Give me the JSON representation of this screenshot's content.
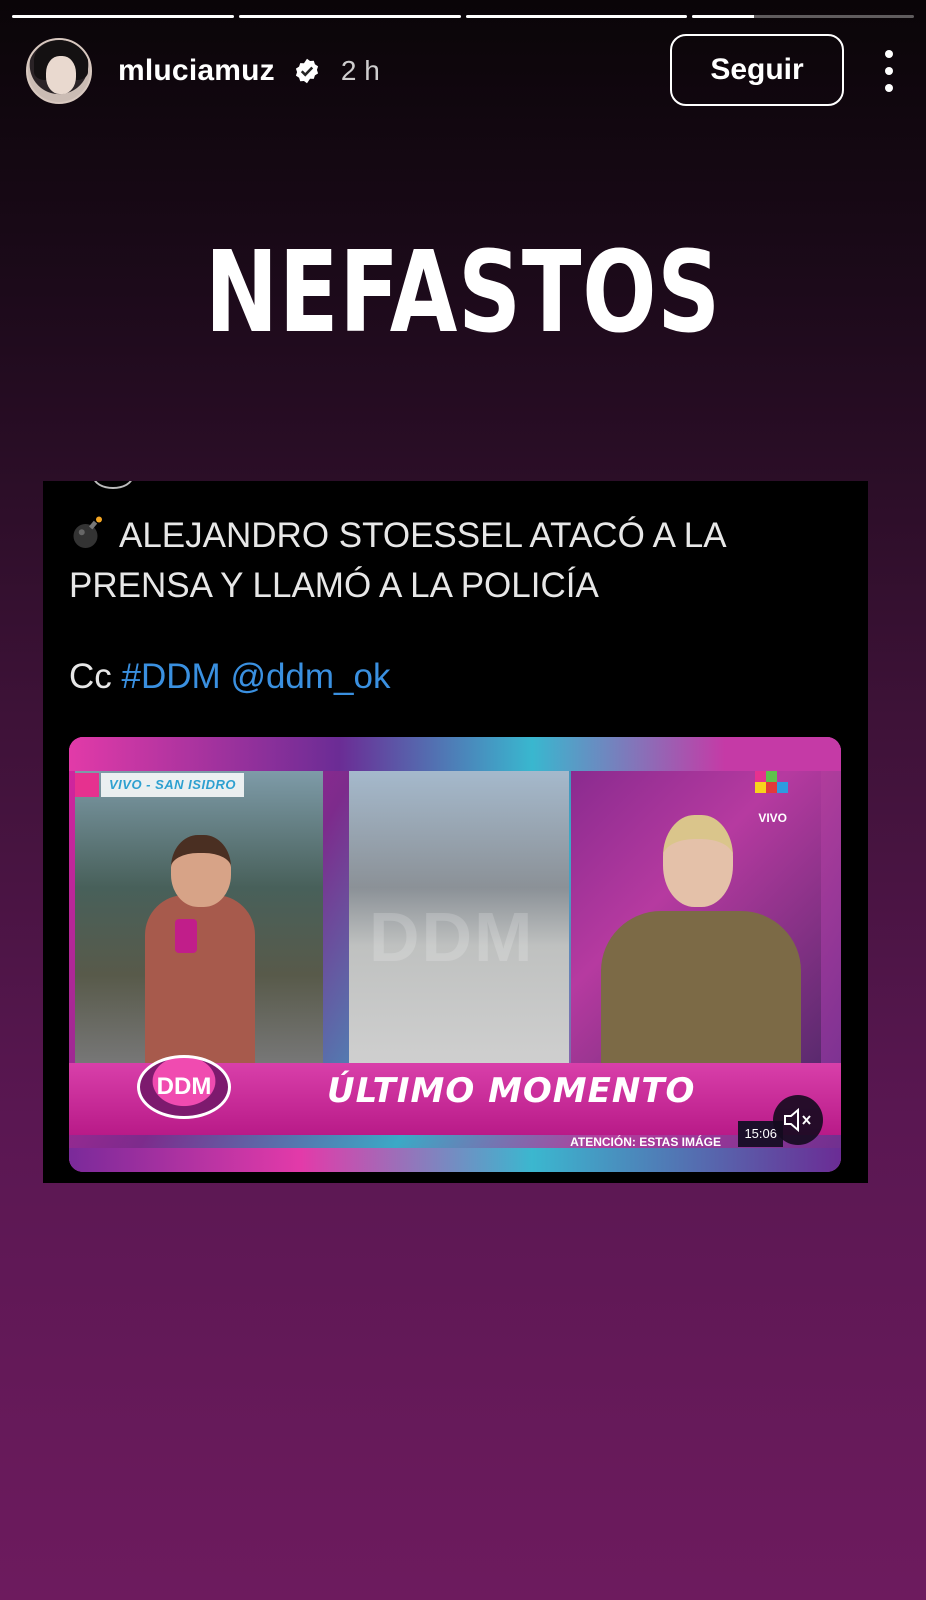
{
  "story": {
    "progress_segments": [
      1,
      1,
      1,
      0.28
    ]
  },
  "header": {
    "username": "mluciamuz",
    "verified": true,
    "time_ago": "2 h",
    "follow_label": "Seguir"
  },
  "headline": "NEFASTOS",
  "tweet": {
    "text": "ALEJANDRO STOESSEL ATACÓ A LA PRENSA Y LLAMÓ A LA POLICÍA",
    "cc_prefix": "Cc",
    "hashtag": "#DDM",
    "mention": "@ddm_ok",
    "video": {
      "live_tag": "VIVO - SAN ISIDRO",
      "channel_live": "VIVO",
      "watermark": "DDM",
      "logo": "DDM",
      "breaking": "ÚLTIMO MOMENTO",
      "ticker": "ATENCIÓN: ESTAS IMÁGE",
      "clock": "15:06",
      "icons": [
        "bomb-icon",
        "mute-icon",
        "verified-icon",
        "more-icon"
      ]
    }
  },
  "colors": {
    "accent_pink": "#d21e9b",
    "link_blue": "#3a90e0"
  }
}
